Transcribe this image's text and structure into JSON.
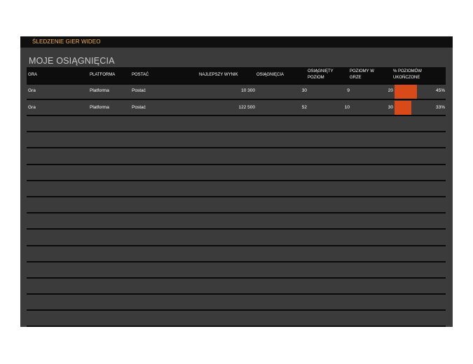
{
  "header": {
    "title": "ŚLEDZENIE GIER WIDEO"
  },
  "section": {
    "title": "MOJE OSIĄGNIĘCIA"
  },
  "columns": {
    "game": "GRA",
    "platform": "PLATFORMA",
    "character": "POSTAĆ",
    "best_score": "NAJLEPSZY WYNIK",
    "achievements": "OSIĄGNIĘCIA",
    "level_reached_1": "OSIĄGNIĘTY",
    "level_reached_2": "POZIOM",
    "levels_in_game_1": "POZIOMY W",
    "levels_in_game_2": "GRZE",
    "pct_complete_1": "% POZIOMÓW",
    "pct_complete_2": "UKOŃCZONE"
  },
  "rows": [
    {
      "game": "Gra",
      "platform": "Platforma",
      "character": "Postać",
      "best_score": "10 300",
      "achievements": "30",
      "level_reached": "9",
      "levels_in_game": "20",
      "pct_complete": "45%",
      "pct_value": 0.45
    },
    {
      "game": "Gra",
      "platform": "Platforma",
      "character": "Postać",
      "best_score": "122 500",
      "achievements": "52",
      "level_reached": "10",
      "levels_in_game": "30",
      "pct_complete": "33%",
      "pct_value": 0.33
    }
  ],
  "colors": {
    "accent": "#d94a1a",
    "title": "#f4b35a",
    "background": "#3b3b3b",
    "header_bg": "#0d0d0d"
  }
}
